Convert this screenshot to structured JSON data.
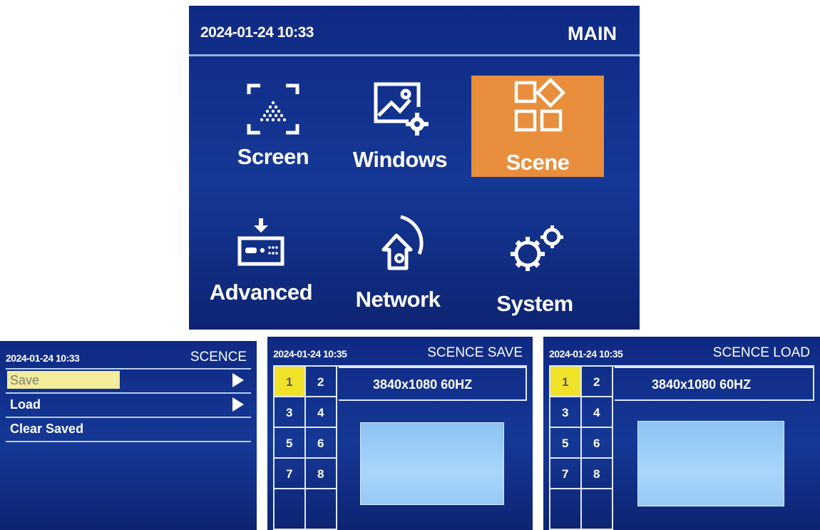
{
  "main": {
    "datetime": "2024-01-24 10:33",
    "title": "MAIN",
    "tiles": [
      {
        "label": "Screen",
        "icon": "screen-icon"
      },
      {
        "label": "Windows",
        "icon": "windows-icon"
      },
      {
        "label": "Scene",
        "icon": "scene-icon",
        "selected": true
      },
      {
        "label": "Advanced",
        "icon": "advanced-icon"
      },
      {
        "label": "Network",
        "icon": "network-icon"
      },
      {
        "label": "System",
        "icon": "system-icon"
      }
    ],
    "selected_color": "#e88e3c"
  },
  "scene_menu": {
    "datetime": "2024-01-24 10:33",
    "title": "SCENCE",
    "items": [
      {
        "label": "Save",
        "has_submenu": true,
        "highlighted": true
      },
      {
        "label": "Load",
        "has_submenu": true
      },
      {
        "label": "Clear Saved",
        "has_submenu": false
      }
    ]
  },
  "scene_save": {
    "datetime": "2024-01-24 10:35",
    "title": "SCENCE SAVE",
    "slots": [
      "1",
      "2",
      "3",
      "4",
      "5",
      "6",
      "7",
      "8"
    ],
    "selected_slot": "1",
    "resolution": "3840x1080 60HZ"
  },
  "scene_load": {
    "datetime": "2024-01-24 10:35",
    "title": "SCENCE LOAD",
    "slots": [
      "1",
      "2",
      "3",
      "4",
      "5",
      "6",
      "7",
      "8"
    ],
    "selected_slot": "1",
    "resolution": "3840x1080 60HZ"
  },
  "colors": {
    "lcd_background": "#153896",
    "slot_highlight": "#f0e229",
    "menu_highlight": "#f3ec9a",
    "preview": "#a8d6fb"
  }
}
